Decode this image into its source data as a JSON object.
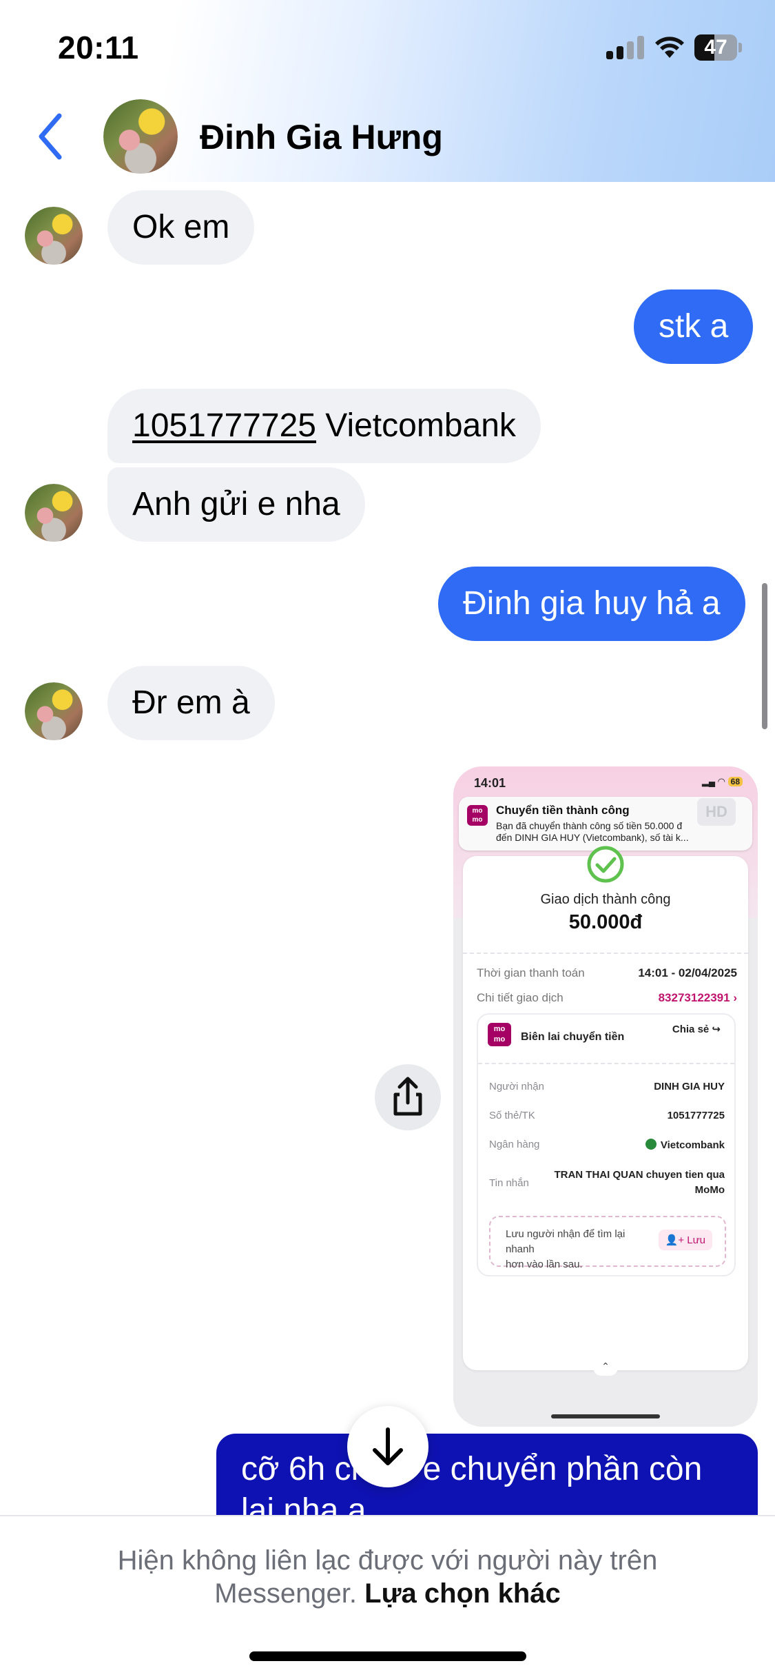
{
  "status_bar": {
    "time": "20:11",
    "battery_level": "47",
    "battery_fraction": 0.47,
    "signal_bars_active": 2,
    "icons": [
      "signal-icon",
      "wifi-icon",
      "battery-icon"
    ]
  },
  "header": {
    "contact_name": "Đinh Gia Hưng",
    "back_icon": "chevron-left-icon",
    "accent_color": "#2F6BF4"
  },
  "messages": [
    {
      "side": "incoming",
      "text": "Ok em"
    },
    {
      "side": "outgoing",
      "text": "stk a"
    },
    {
      "side": "incoming",
      "account_number": "1051777725",
      "bank": "Vietcombank"
    },
    {
      "side": "incoming",
      "text": "Anh gửi e nha"
    },
    {
      "side": "outgoing",
      "text": "Đinh gia huy hả a"
    },
    {
      "side": "incoming",
      "text": "Đr em à"
    },
    {
      "side": "outgoing",
      "text": "cỡ 6h chiều e chuyển phần còn lại nha a"
    }
  ],
  "shared_image": {
    "time": "14:01",
    "battery": "68",
    "notification": {
      "logo": "mo mo",
      "title": "Chuyển tiền thành công",
      "body_line1": "Bạn đã chuyển thành công số tiền 50.000 đ",
      "body_line2": "đến DINH GIA HUY (Vietcombank), số tài k..."
    },
    "hd_badge": "HD",
    "status_title": "Giao dịch thành công",
    "amount": "50.000đ",
    "payment_time_label": "Thời gian thanh toán",
    "payment_time_value": "14:01 - 02/04/2025",
    "detail_label": "Chi tiết giao dịch",
    "detail_value": "83273122391",
    "receipt_title": "Biên lai chuyển tiền",
    "share_label": "Chia sẻ",
    "recipient_label": "Người nhận",
    "recipient_value": "DINH GIA HUY",
    "account_label": "Số thẻ/TK",
    "account_value": "1051777725",
    "bank_label": "Ngân hàng",
    "bank_value": "Vietcombank",
    "message_label": "Tin nhắn",
    "message_value_line1": "TRAN THAI QUAN chuyen tien qua",
    "message_value_line2": "MoMo",
    "save_hint_line1": "Lưu người nhận để tìm lại nhanh",
    "save_hint_line2": "hơn vào lần sau.",
    "save_button": "Lưu"
  },
  "footer": {
    "notice_line1": "Hiện không liên lạc được với người này trên",
    "notice_line2": "Messenger.",
    "link": "Lựa chọn khác"
  },
  "colors": {
    "outgoing_bubble": "#2F6BF4",
    "outgoing_bubble_dark": "#0F12B2",
    "incoming_bubble": "#F0F1F5",
    "momo_brand": "#A50064"
  }
}
